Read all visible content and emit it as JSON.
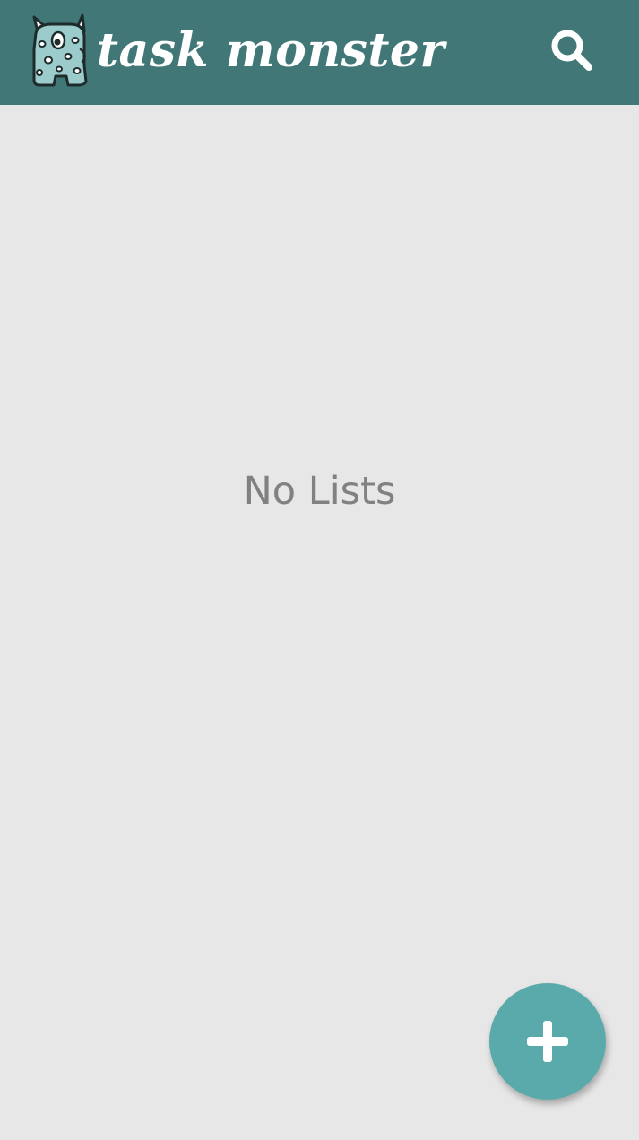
{
  "app_bar": {
    "title": "task monster",
    "logo_icon": "monster-logo-icon",
    "search_icon": "search-icon",
    "background_color": "#417877"
  },
  "main": {
    "empty_message": "No Lists",
    "background_color": "#e8e7e8"
  },
  "fab": {
    "icon": "plus-icon",
    "color": "#5aaaab"
  }
}
